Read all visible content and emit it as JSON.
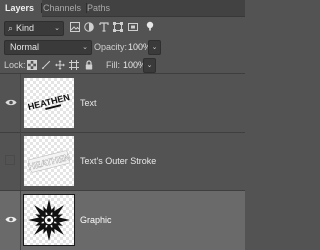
{
  "tabs": [
    {
      "label": "Layers",
      "active": true
    },
    {
      "label": "Channels",
      "active": false
    },
    {
      "label": "Paths",
      "active": false
    }
  ],
  "filter": {
    "kind_label": "Kind",
    "icons": [
      "image-filter-icon",
      "adjustment-filter-icon",
      "type-filter-icon",
      "shape-filter-icon",
      "smart-object-filter-icon",
      "filter-toggle-icon"
    ]
  },
  "blend": {
    "mode": "Normal",
    "opacity_label": "Opacity:",
    "opacity_value": "100%"
  },
  "lock": {
    "label": "Lock:",
    "icons": [
      "lock-transparent-icon",
      "lock-image-icon",
      "lock-position-icon",
      "lock-artboard-icon",
      "lock-all-icon"
    ],
    "fill_label": "Fill:",
    "fill_value": "100%"
  },
  "layers": [
    {
      "name": "Text",
      "visible": true,
      "selected": false,
      "thumb_text": "HEATHEN"
    },
    {
      "name": "Text's Outer Stroke",
      "visible": false,
      "selected": false,
      "thumb_text": "HEATHEN"
    },
    {
      "name": "Graphic",
      "visible": true,
      "selected": true
    }
  ],
  "colors": {
    "panel_bg": "#535353",
    "selected_row": "#6a6a6a",
    "tab_bar": "#424242"
  }
}
